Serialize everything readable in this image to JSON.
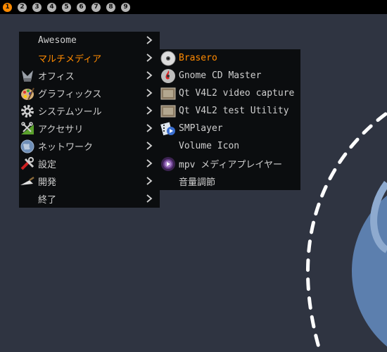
{
  "tags": [
    "1",
    "2",
    "3",
    "4",
    "5",
    "6",
    "7",
    "8",
    "9"
  ],
  "main_menu": {
    "items": [
      {
        "label": "Awesome"
      },
      {
        "label": "マルチメディア"
      },
      {
        "label": "オフィス"
      },
      {
        "label": "グラフィックス"
      },
      {
        "label": "システムツール"
      },
      {
        "label": "アクセサリ"
      },
      {
        "label": "ネットワーク"
      },
      {
        "label": "設定"
      },
      {
        "label": "開発"
      },
      {
        "label": "終了"
      }
    ]
  },
  "sub_menu": {
    "items": [
      {
        "label": "Brasero"
      },
      {
        "label": "Gnome CD Master"
      },
      {
        "label": "Qt V4L2 video capture …"
      },
      {
        "label": "Qt V4L2 test Utility"
      },
      {
        "label": "SMPlayer"
      },
      {
        "label": "Volume Icon"
      },
      {
        "label": "mpv メディアプレイヤー"
      },
      {
        "label": "音量調節"
      }
    ]
  },
  "colors": {
    "background": "#2f3441",
    "wibar": "#000000",
    "menu_bg": "#0b0d0f",
    "menu_text": "#cfcfcf",
    "highlight": "#ff8a00"
  }
}
